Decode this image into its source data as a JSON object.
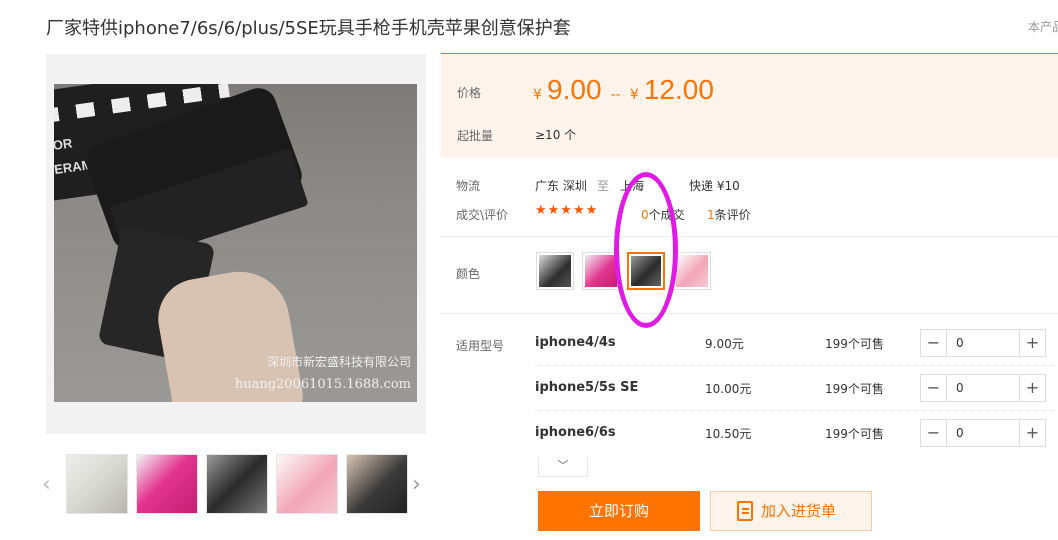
{
  "product": {
    "title": "厂家特供iphone7/6s/6/plus/5SE玩具手枪手机壳苹果创意保护套",
    "corner_note": "本产品"
  },
  "gallery": {
    "watermark_company": "深圳市新宏盛科技有限公司",
    "watermark_site": "huang20061015.1688.com",
    "clapper_text_1": "OR",
    "clapper_text_2": "ERAMAN",
    "prev_icon": "chevron-left-icon",
    "next_icon": "chevron-right-icon",
    "thumb_colors": [
      "#d8d8d2",
      "#e2348f",
      "#2a2a2a",
      "#f2a6b8",
      "#3a3a3a"
    ]
  },
  "price": {
    "label": "价格",
    "currency": "¥",
    "min": "9.00",
    "separator": "--",
    "max": "12.00",
    "moq_label": "起批量",
    "moq_value": "≥10 个"
  },
  "logistics": {
    "label": "物流",
    "from": "广东 深圳",
    "to_word": "至",
    "to": "上海",
    "method": "快递 ¥10"
  },
  "reviews": {
    "label": "成交\\评价",
    "stars": "★★★★★",
    "deals_count": "0",
    "deals_suffix": "个成交",
    "reviews_count": "1",
    "reviews_suffix": "条评价"
  },
  "color": {
    "label": "颜色",
    "swatches": [
      "#2e2e2e",
      "#e2348f",
      "#2a2a2a",
      "#f2a6b8"
    ],
    "selected_index": 2
  },
  "models": {
    "label": "适用型号",
    "rows": [
      {
        "name": "iphone4/4s",
        "price": "9.00元",
        "stock": "199个可售",
        "qty": "0"
      },
      {
        "name": "iphone5/5s SE",
        "price": "10.00元",
        "stock": "199个可售",
        "qty": "0"
      },
      {
        "name": "iphone6/6s",
        "price": "10.50元",
        "stock": "199个可售",
        "qty": "0"
      }
    ],
    "minus": "−",
    "plus": "+",
    "expand_icon": "chevron-down-icon",
    "expand_glyph": "﹀"
  },
  "actions": {
    "buy_label": "立即订购",
    "cart_label": "加入进货单",
    "cart_icon": "clipboard-icon"
  },
  "annotation": {
    "circle_color": "#e11be6"
  }
}
